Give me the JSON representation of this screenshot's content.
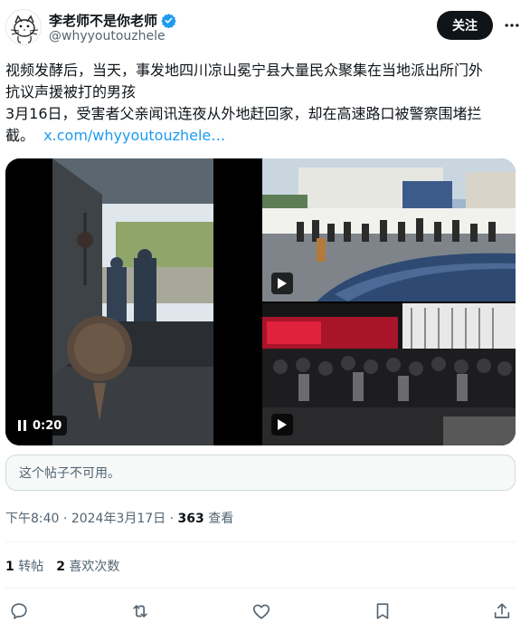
{
  "author": {
    "display_name": "李老师不是你老师",
    "handle": "@whyyoutouzhele",
    "verified": true
  },
  "follow_label": "关注",
  "post": {
    "line1": "视频发酵后，当天，事发地四川凉山冕宁县大量民众聚集在当地派出所门外",
    "line2": "抗议声援被打的男孩",
    "line3": "3月16日，受害者父亲闻讯连夜从外地赶回家，却在高速路口被警察围堵拦",
    "line4": "截。",
    "link": "x.com/whyyoutouzhele…"
  },
  "media": {
    "video_time": "0:20"
  },
  "quote_unavailable": "这个帖子不可用。",
  "meta": {
    "time": "下午8:40",
    "sep1": " · ",
    "date": "2024年3月17日",
    "sep2": " · ",
    "views_count": "363",
    "views_label": " 查看"
  },
  "stats": {
    "reposts_count": "1",
    "reposts_label": "转帖",
    "likes_count": "2",
    "likes_label": "喜欢次数"
  },
  "icons": {
    "reply": "reply-icon",
    "repost": "repost-icon",
    "like": "heart-icon",
    "bookmark": "bookmark-icon",
    "share": "share-icon"
  },
  "colors": {
    "link": "#1d9bf0",
    "text": "#0f1419",
    "muted": "#536471",
    "verified": "#1d9bf0"
  }
}
